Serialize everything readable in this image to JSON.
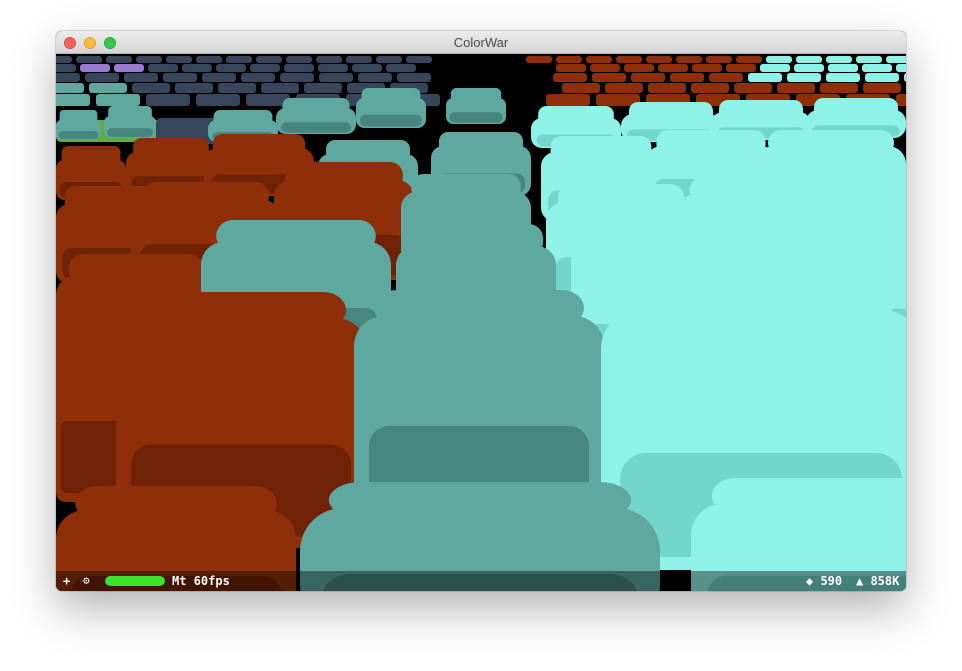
{
  "window": {
    "title": "ColorWar"
  },
  "colors": {
    "brick_top": "#8e2f0a",
    "brick_side": "#4a1502",
    "teal_top": "#5ea8a0",
    "teal_side": "#2d5c57",
    "cyan_top": "#8ff2e8",
    "cyan_side": "#4fb3a9",
    "navy": "#38465c",
    "green": "#5fae3a",
    "purple": "#9a7ad0",
    "fps_bar": "#3ee12b"
  },
  "hud": {
    "add_icon": "+",
    "settings_icon": "⚙",
    "fps_level": 1.0,
    "fps_text": "Mt 60fps",
    "entities_text": "◆ 590",
    "triangles_text": "▲ 858K"
  }
}
